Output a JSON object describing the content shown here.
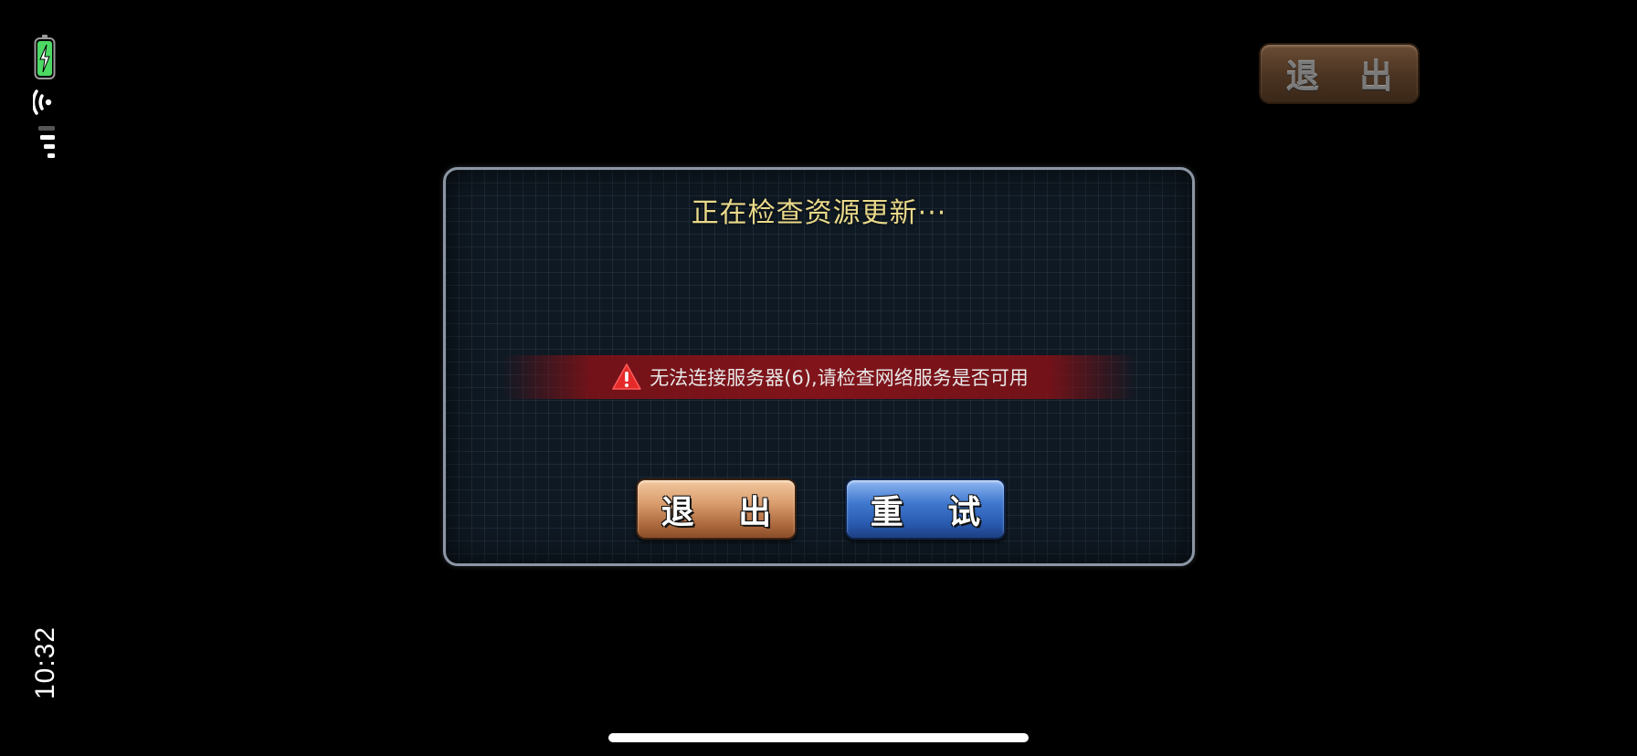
{
  "status_bar": {
    "time": "10:32",
    "battery_icon": "battery-charging-icon",
    "wifi_icon": "wifi-icon",
    "signal_icon": "cellular-signal-icon",
    "battery_color": "#4cd964"
  },
  "top_bar": {
    "exit_label": "退 出"
  },
  "dialog": {
    "title": "正在检查资源更新···",
    "error_icon": "warning-triangle-icon",
    "error_message": "无法连接服务器(6),请检查网络服务是否可用",
    "exit_label": "退 出",
    "retry_label": "重 试",
    "title_color": "#e9d98a",
    "error_banner_color": "#80141a",
    "exit_button_color": "#d99d6e",
    "retry_button_color": "#3f78cf"
  }
}
